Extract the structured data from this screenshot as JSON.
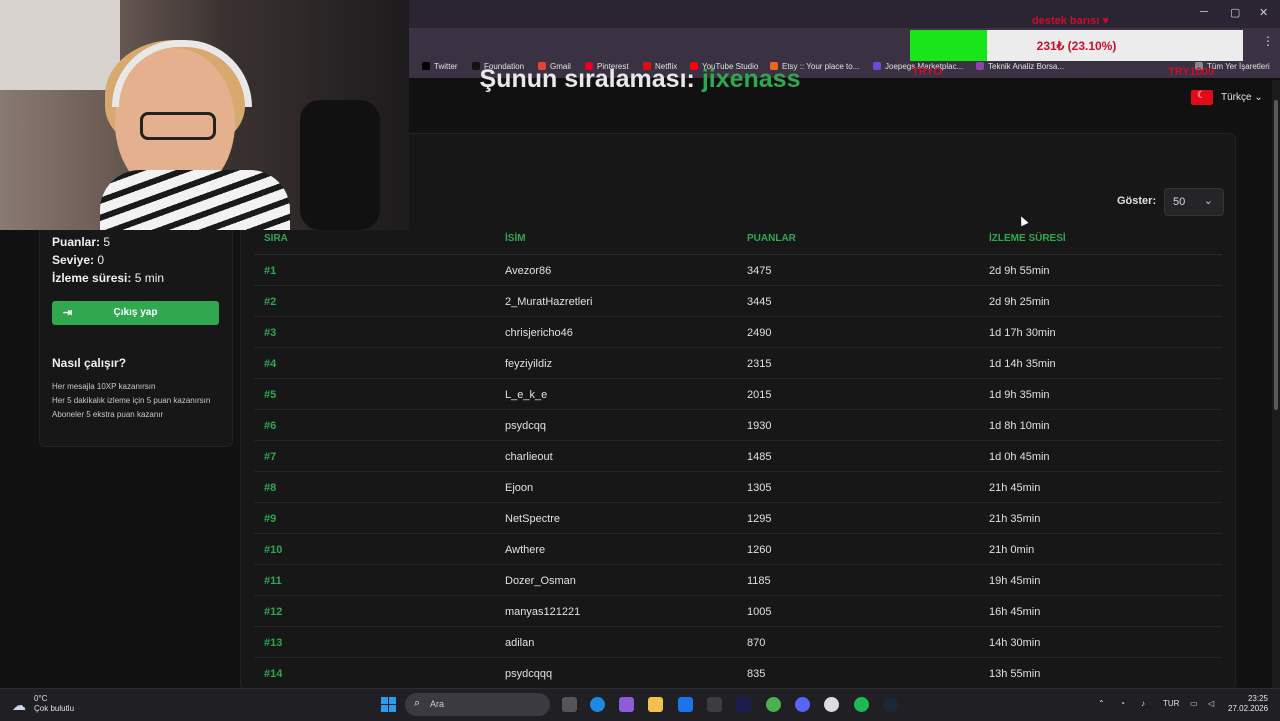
{
  "bookmarks": [
    {
      "label": "Twitter",
      "color": "#000000"
    },
    {
      "label": "Foundation",
      "color": "#111111"
    },
    {
      "label": "Gmail",
      "color": "#ea4335"
    },
    {
      "label": "Pinterest",
      "color": "#e60023"
    },
    {
      "label": "Netflix",
      "color": "#e50914"
    },
    {
      "label": "YouTube Studio",
      "color": "#ff0000"
    },
    {
      "label": "Etsy :: Your place to...",
      "color": "#f1641e"
    },
    {
      "label": "Joepegs Marketplac...",
      "color": "#6c4bd6"
    },
    {
      "label": "Teknik Analiz Borsa...",
      "color": "#8e44ad"
    },
    {
      "label": "Tüm Yer İşaretleri",
      "color": "#888888"
    }
  ],
  "overlay": {
    "title": "destek barısı ♥",
    "amount_text": "231₺ (23.10%)",
    "progress_fraction": 0.231,
    "left_red": "TRYO",
    "right_red": "TRY1000",
    "accent": "#19e619",
    "text_color": "#c8102e"
  },
  "header": {
    "language": "Türkçe"
  },
  "leaderboard": {
    "title_prefix": "Şunun sıralaması:",
    "username": "jixenass",
    "show_label": "Göster:",
    "show_value": "50",
    "columns": [
      "SIRA",
      "İSİM",
      "PUANLAR",
      "İZLEME SÜRESİ"
    ],
    "rows": [
      {
        "rank": "#1",
        "name": "Avezor86",
        "points": "3475",
        "time": "2d 9h 55min"
      },
      {
        "rank": "#2",
        "name": "2_MuratHazretleri",
        "points": "3445",
        "time": "2d 9h 25min"
      },
      {
        "rank": "#3",
        "name": "chrisjericho46",
        "points": "2490",
        "time": "1d 17h 30min"
      },
      {
        "rank": "#4",
        "name": "feyziyildiz",
        "points": "2315",
        "time": "1d 14h 35min"
      },
      {
        "rank": "#5",
        "name": "L_e_k_e",
        "points": "2015",
        "time": "1d 9h 35min"
      },
      {
        "rank": "#6",
        "name": "psydcqq",
        "points": "1930",
        "time": "1d 8h 10min"
      },
      {
        "rank": "#7",
        "name": "charlieout",
        "points": "1485",
        "time": "1d 0h 45min"
      },
      {
        "rank": "#8",
        "name": "Ejoon",
        "points": "1305",
        "time": "21h 45min"
      },
      {
        "rank": "#9",
        "name": "NetSpectre",
        "points": "1295",
        "time": "21h 35min"
      },
      {
        "rank": "#10",
        "name": "Awthere",
        "points": "1260",
        "time": "21h 0min"
      },
      {
        "rank": "#11",
        "name": "Dozer_Osman",
        "points": "1185",
        "time": "19h 45min"
      },
      {
        "rank": "#12",
        "name": "manyas121221",
        "points": "1005",
        "time": "16h 45min"
      },
      {
        "rank": "#13",
        "name": "adilan",
        "points": "870",
        "time": "14h 30min"
      },
      {
        "rank": "#14",
        "name": "psydcqqq",
        "points": "835",
        "time": "13h 55min"
      }
    ]
  },
  "profile": {
    "points_label": "Puanlar:",
    "points_value": "5",
    "level_label": "Seviye:",
    "level_value": "0",
    "watch_label": "İzleme süresi:",
    "watch_value": "5 min",
    "logout_label": "Çıkış yap",
    "how_title": "Nasıl çalışır?",
    "how_lines": [
      "Her mesajla 10XP kazanırsın",
      "Her 5 dakikalık izleme için 5 puan kazanırsın",
      "Aboneler 5 ekstra puan kazanır"
    ]
  },
  "taskbar": {
    "temp": "0°C",
    "weather": "Çok bulutlu",
    "search_placeholder": "Ara",
    "lang": "TUR",
    "time": "23:25",
    "date": "27.02.2026"
  },
  "colors": {
    "accent": "#2fa84f",
    "background": "#111112"
  }
}
